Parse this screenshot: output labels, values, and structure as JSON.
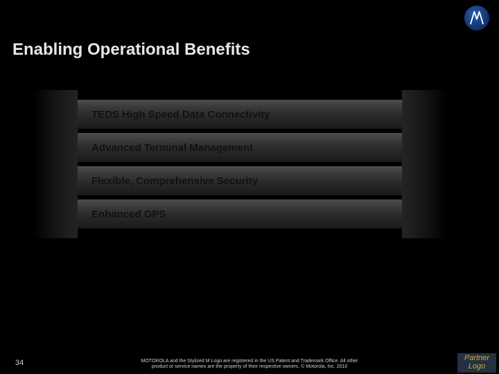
{
  "title": "Enabling Operational Benefits",
  "items": [
    "TEDS High Speed Data Connectivity",
    "Advanced Terminal Management",
    "Flexible, Comprehensive Security",
    "Enhanced GPS"
  ],
  "page_number": "34",
  "legal_line1": "MOTOROLA and the Stylized M Logo are registered in the US Patent and Trademark Office. All other",
  "legal_line2": "product or service names are the property of their respective owners. © Motorola, Inc. 2010",
  "partner_label": "Partner Logo",
  "logo_name": "motorola-logo"
}
